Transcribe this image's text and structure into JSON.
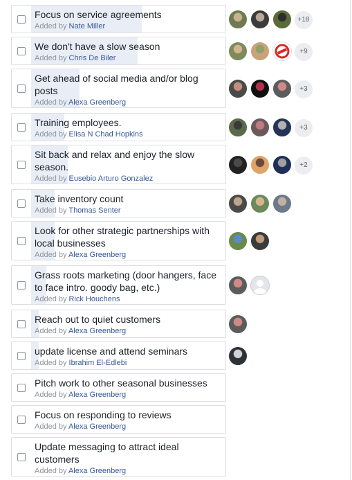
{
  "accent_color": "#385898",
  "vote_bar_color": "#e9edf5",
  "added_by_prefix": "Added by",
  "options": [
    {
      "label": "Focus on service agreements",
      "added_by": "Nate Miller",
      "vote_share": 0.57,
      "voters": [
        {
          "icon": "person-avatar",
          "colors": [
            "#6f7a52",
            "#c9b38f"
          ]
        },
        {
          "icon": "person-avatar",
          "colors": [
            "#3b3b3b",
            "#b8a89a"
          ]
        },
        {
          "icon": "person-avatar",
          "colors": [
            "#5a6b3a",
            "#2d2d2d"
          ]
        }
      ],
      "more": "+18"
    },
    {
      "label": "We don't have a slow season",
      "added_by": "Chris De Biler",
      "vote_share": 0.55,
      "voters": [
        {
          "icon": "person-avatar",
          "colors": [
            "#7c8a5c",
            "#d4b48c"
          ]
        },
        {
          "icon": "person-avatar",
          "colors": [
            "#c9a27a",
            "#8fa06a"
          ]
        },
        {
          "icon": "logo-avatar",
          "colors": [
            "#ffffff",
            "#d42a2a"
          ]
        }
      ],
      "more": "+9"
    },
    {
      "label": "Get ahead of social media and/or blog posts",
      "added_by": "Alexa Greenberg",
      "vote_share": 0.25,
      "voters": [
        {
          "icon": "person-avatar",
          "colors": [
            "#4a4a4a",
            "#c48f7a"
          ]
        },
        {
          "icon": "person-avatar",
          "colors": [
            "#111111",
            "#b0324a"
          ]
        },
        {
          "icon": "person-avatar",
          "colors": [
            "#5c5c5c",
            "#d08a86"
          ]
        }
      ],
      "more": "+3"
    },
    {
      "label": "Training employees.",
      "added_by": "Elisa N Chad Hopkins",
      "vote_share": 0.17,
      "voters": [
        {
          "icon": "person-avatar",
          "colors": [
            "#5a6a4a",
            "#3a3a3a"
          ]
        },
        {
          "icon": "person-avatar",
          "colors": [
            "#6c5a5a",
            "#c07a80"
          ]
        },
        {
          "icon": "person-avatar",
          "colors": [
            "#243458",
            "#b2b2b2"
          ]
        }
      ],
      "more": "+3"
    },
    {
      "label": "Sit back and relax and enjoy the slow season.",
      "added_by": "Eusebio Arturo Gonzalez",
      "vote_share": 0.19,
      "voters": [
        {
          "icon": "person-avatar",
          "colors": [
            "#222222",
            "#4a4a4a"
          ]
        },
        {
          "icon": "person-avatar",
          "colors": [
            "#e0a46a",
            "#6a4a3a"
          ]
        },
        {
          "icon": "person-avatar",
          "colors": [
            "#1f2f58",
            "#a0a0a0"
          ]
        }
      ],
      "more": "+2"
    },
    {
      "label": "Take inventory count",
      "added_by": "Thomas Senter",
      "vote_share": 0.12,
      "voters": [
        {
          "icon": "person-avatar",
          "colors": [
            "#4a4a4a",
            "#bfa48a"
          ]
        },
        {
          "icon": "person-avatar",
          "colors": [
            "#6a8a5a",
            "#d8b48c"
          ]
        },
        {
          "icon": "person-avatar",
          "colors": [
            "#6a7a8a",
            "#c4b0a0"
          ]
        }
      ],
      "more": ""
    },
    {
      "label": "Look for other strategic partnerships with local businesses",
      "added_by": "Alexa Greenberg",
      "vote_share": 0.12,
      "voters": [
        {
          "icon": "person-avatar",
          "colors": [
            "#6a8a4a",
            "#5a8ac8"
          ]
        },
        {
          "icon": "person-avatar",
          "colors": [
            "#3a3a3a",
            "#c09a7a"
          ]
        }
      ],
      "more": ""
    },
    {
      "label": "Grass roots marketing (door hangers, face to face intro. goody bag, etc.)",
      "added_by": "Rick Houchens",
      "vote_share": 0.08,
      "voters": [
        {
          "icon": "person-avatar",
          "colors": [
            "#5c5c5c",
            "#d08a86"
          ]
        },
        {
          "icon": "default-avatar",
          "colors": [
            "#e4e6eb",
            "#c8cbd0"
          ]
        }
      ],
      "more": ""
    },
    {
      "label": "Reach out to quiet customers",
      "added_by": "Alexa Greenberg",
      "vote_share": 0.04,
      "voters": [
        {
          "icon": "person-avatar",
          "colors": [
            "#5c5c5c",
            "#d08a86"
          ]
        }
      ],
      "more": ""
    },
    {
      "label": "update license and attend seminars",
      "added_by": "Ibrahim El-Edlebi",
      "vote_share": 0.04,
      "voters": [
        {
          "icon": "person-avatar",
          "colors": [
            "#2e3238",
            "#d0d4d8"
          ]
        }
      ],
      "more": ""
    },
    {
      "label": "Pitch work to other seasonal businesses",
      "added_by": "Alexa Greenberg",
      "vote_share": 0,
      "voters": [],
      "more": ""
    },
    {
      "label": "Focus on responding to reviews",
      "added_by": "Alexa Greenberg",
      "vote_share": 0,
      "voters": [],
      "more": ""
    },
    {
      "label": "Update messaging to attract ideal customers",
      "added_by": "Alexa Greenberg",
      "vote_share": 0,
      "voters": [],
      "more": ""
    }
  ]
}
